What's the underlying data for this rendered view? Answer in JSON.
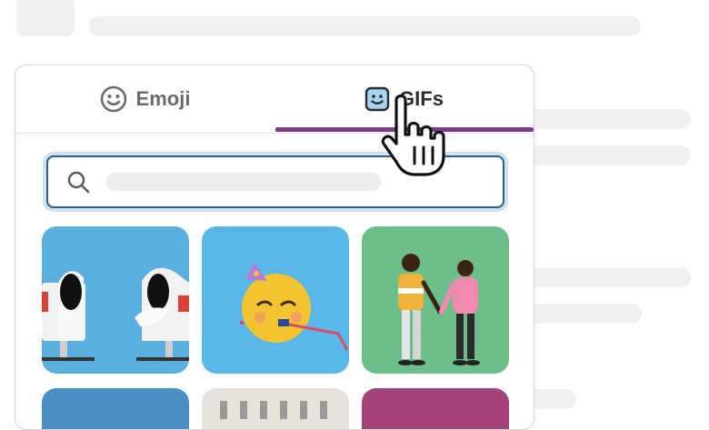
{
  "picker": {
    "tabs": [
      {
        "label": "Emoji",
        "icon": "smiley-face-icon"
      },
      {
        "label": "GIFs",
        "icon": "gif-face-icon",
        "active": true
      }
    ],
    "accent_color": "#7a3a8e"
  },
  "search": {
    "icon": "search-icon"
  }
}
